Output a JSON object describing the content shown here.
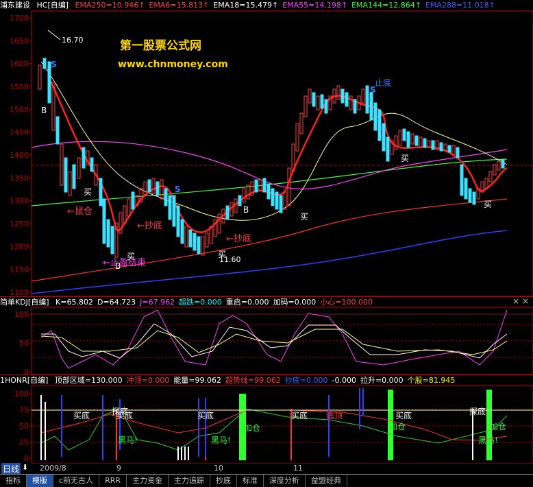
{
  "main": {
    "title": "浦东建设",
    "mode": "HC[自编]",
    "indicators": [
      {
        "label": "EMA250=10.946↑",
        "color": "#ff4040"
      },
      {
        "label": "EMA6=15.813↑",
        "color": "#ff4040"
      },
      {
        "label": "EMA18=15.479↑",
        "color": "#ffffff"
      },
      {
        "label": "EMA55=14.198↑",
        "color": "#ff40ff"
      },
      {
        "label": "EMA144=12.864↑",
        "color": "#40ff40"
      },
      {
        "label": "EMA288=11.018↑",
        "color": "#4060ff"
      }
    ],
    "y_ticks": [
      "1700",
      "1650",
      "1600",
      "1550",
      "1500",
      "1450",
      "1400",
      "1350",
      "1300",
      "1250",
      "1200",
      "1150",
      "1100"
    ],
    "watermark_title": "第一股票公式网",
    "watermark_url": "www.chnmoney.com",
    "annotations": {
      "high": "16.70",
      "low": "11.60",
      "buy1": "买",
      "buy2": "买",
      "buy3": "买",
      "buy4": "买",
      "buy5": "买",
      "buy6": "买",
      "buy7": "买",
      "rat_warehouse": "←鼠仓",
      "bottom1": "←抄底",
      "bottom2": "←抄底",
      "loss_end": "←止盈结束",
      "zhidi": "止底",
      "S": "S",
      "B": "B"
    }
  },
  "kdj": {
    "title": "简单KDJ[自编]",
    "values": [
      {
        "label": "K=65.802",
        "color": "#ffffff"
      },
      {
        "label": "D=64.723",
        "color": "#ffffff"
      },
      {
        "label": "J=67.962",
        "color": "#ff40ff"
      },
      {
        "label": "超跌=0.000",
        "color": "#00ffff"
      },
      {
        "label": "重启=0.000",
        "color": "#ffffff"
      },
      {
        "label": "加码=0.000",
        "color": "#ffffff"
      },
      {
        "label": "小心=100.000",
        "color": "#ff4040"
      }
    ],
    "y_ticks": [
      "100",
      "50",
      "0"
    ]
  },
  "honr": {
    "title": "1HONR[自编]",
    "values": [
      {
        "label": "顶部区域=130.000",
        "color": "#ffffff"
      },
      {
        "label": "冲顶=0.000",
        "color": "#ff4040"
      },
      {
        "label": "能量=99.062",
        "color": "#ffffff"
      },
      {
        "label": "超势线=99.062",
        "color": "#ff4040"
      },
      {
        "label": "抄底=0.000",
        "color": "#4060ff"
      },
      {
        "label": "-0.000",
        "color": "#ffffff"
      },
      {
        "label": "拉升=0.000",
        "color": "#ffffff"
      },
      {
        "label": "个股=81.945",
        "color": "#ffff00"
      }
    ],
    "y_ticks": [
      "100",
      "75",
      "50",
      "25",
      "0"
    ],
    "labels": {
      "buy_bottom1": "买底",
      "buy_bottom2": "买底",
      "buy_bottom3": "买底",
      "buy_bottom4": "买底",
      "explore_bottom1": "探底",
      "explore_bottom2": "探底",
      "buy_bottom5": "买底",
      "escape": "逃顶",
      "add1": "加仓",
      "add2": "加仓",
      "add3": "加仓",
      "dark_horse1": "黑马!",
      "dark_horse2": "黑马!",
      "dark_horse3": "黑马!"
    }
  },
  "x_axis": {
    "period_label": "日线",
    "period_arrow": "⬇",
    "dates": [
      "2009/8",
      "9",
      "10",
      "11"
    ]
  },
  "tabs": [
    "指标",
    "模版",
    "c前无古人",
    "RRR",
    "主力资金",
    "主力追踪",
    "抄底",
    "标准",
    "深度分析",
    "益盟经典"
  ],
  "active_tab_index": 1,
  "close_icons": [
    "×",
    "×"
  ]
}
